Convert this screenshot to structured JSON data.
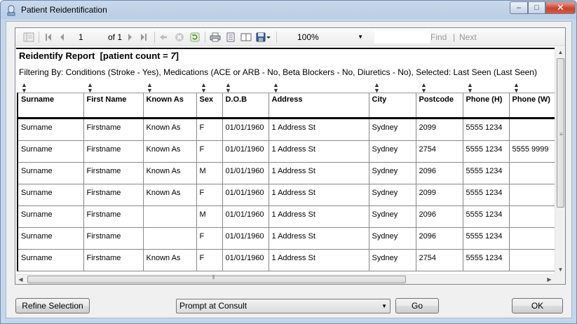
{
  "window": {
    "title": "Patient Reidentification",
    "minimize": "–",
    "maximize": "□",
    "close": "✕"
  },
  "toolbar": {
    "page_current": "1",
    "page_of": "of 1",
    "zoom": "100%",
    "find_label": "Find",
    "find_separator": "|",
    "next_label": "Next",
    "icons": [
      "document-map-icon",
      "first-page-icon",
      "previous-page-icon",
      "next-page-icon",
      "last-page-icon",
      "back-icon",
      "stop-icon",
      "refresh-icon",
      "print-icon",
      "print-layout-icon",
      "page-setup-icon",
      "export-icon"
    ]
  },
  "report": {
    "title": "Reidentify Report",
    "count_label": "[patient count = ",
    "count_value": "7",
    "count_close": "]",
    "filter": "Filtering By: Conditions (Stroke - Yes), Medications (ACE or ARB - No, Beta Blockers - No, Diuretics - No), Selected: Last Seen (Last Seen)",
    "columns": [
      "Surname",
      "First Name",
      "Known As",
      "Sex",
      "D.O.B",
      "Address",
      "City",
      "Postcode",
      "Phone (H)",
      "Phone (W)"
    ],
    "rows": [
      [
        "Surname",
        "Firstname",
        "Known As",
        "F",
        "01/01/1960",
        "1 Address St",
        "Sydney",
        "2099",
        "5555 1234",
        ""
      ],
      [
        "Surname",
        "Firstname",
        "Known As",
        "F",
        "01/01/1960",
        "1 Address St",
        "Sydney",
        "2754",
        "5555 1234",
        "5555 9999"
      ],
      [
        "Surname",
        "Firstname",
        "Known As",
        "M",
        "01/01/1960",
        "1 Address St",
        "Sydney",
        "2096",
        "5555 1234",
        ""
      ],
      [
        "Surname",
        "Firstname",
        "Known As",
        "F",
        "01/01/1960",
        "1 Address St",
        "Sydney",
        "2099",
        "5555 1234",
        ""
      ],
      [
        "Surname",
        "Firstname",
        "",
        "M",
        "01/01/1960",
        "1 Address St",
        "Sydney",
        "2096",
        "5555 1234",
        ""
      ],
      [
        "Surname",
        "Firstname",
        "",
        "F",
        "01/01/1960",
        "1 Address St",
        "Sydney",
        "2096",
        "5555 1234",
        ""
      ],
      [
        "Surname",
        "Firstname",
        "Known As",
        "F",
        "01/01/1960",
        "1 Address St",
        "Sydney",
        "2754",
        "5555 1234",
        ""
      ]
    ]
  },
  "footer": {
    "refine_label": "Refine Selection",
    "action_selected": "Prompt at Consult",
    "go_label": "Go",
    "ok_label": "OK"
  },
  "colors": {
    "title_bar": "#c9d9ec",
    "close_button": "#c8452d",
    "dialog_bg": "#f0f0f0"
  }
}
